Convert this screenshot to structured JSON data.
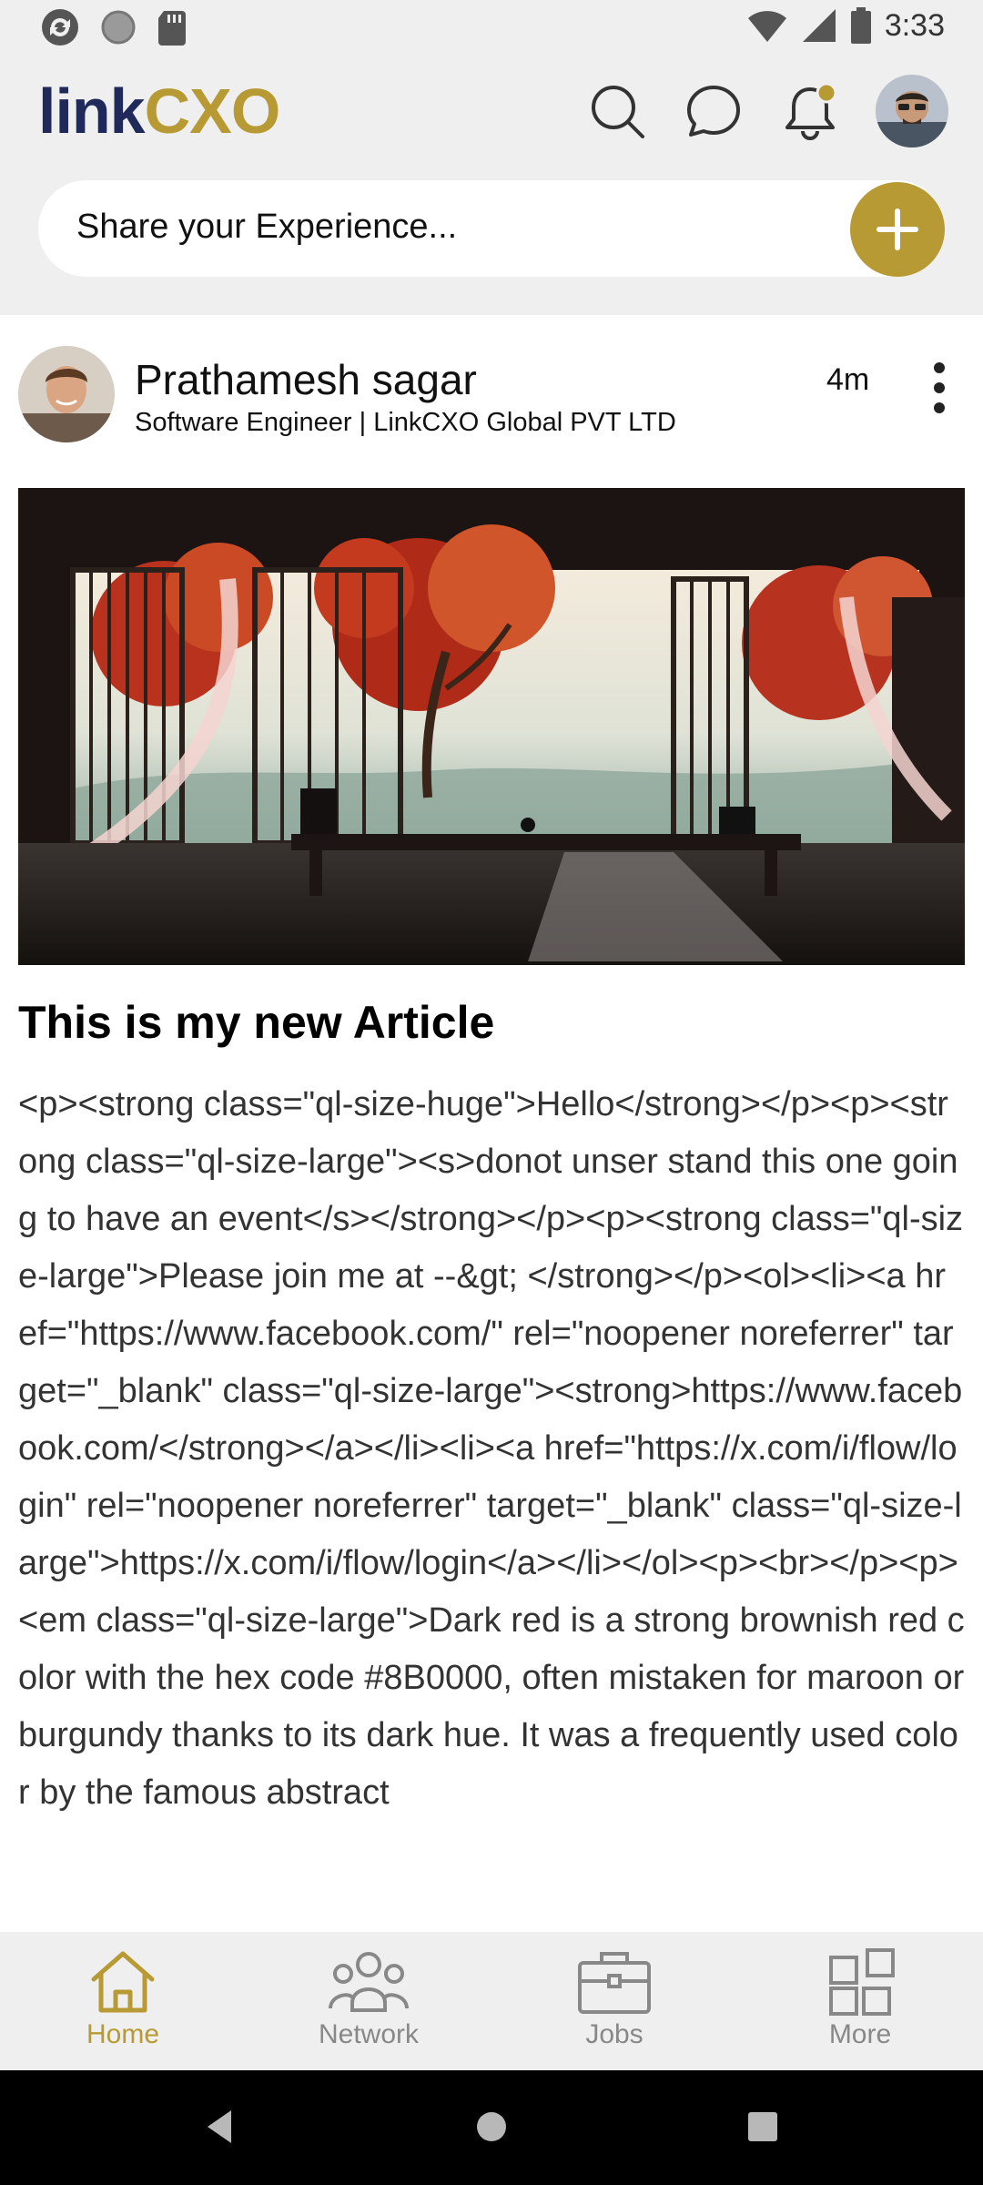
{
  "status_bar": {
    "time": "3:33",
    "left_icons": [
      "sync-icon",
      "circle-icon",
      "sdcard-icon"
    ],
    "right_icons": [
      "wifi-icon",
      "signal-icon",
      "battery-icon"
    ]
  },
  "header": {
    "logo_part1": "link",
    "logo_part2": "CXO",
    "icons": [
      "search-icon",
      "chat-icon",
      "bell-icon",
      "profile-avatar"
    ]
  },
  "share": {
    "placeholder": "Share your Experience...",
    "add_icon": "plus-icon"
  },
  "post": {
    "author_name": "Prathamesh sagar",
    "author_title": "Software  Engineer | LinkCXO Global PVT LTD",
    "time": "4m",
    "menu_icon": "more-vertical-icon",
    "title": "This is my new Article",
    "body": "<p><strong class=\"ql-size-huge\">Hello</strong></p><p><strong class=\"ql-size-large\"><s>donot unser stand this one going to have an event</s></strong></p><p><strong class=\"ql-size-large\">Please join me at  --&gt; </strong></p><ol><li><a href=\"https://www.facebook.com/\" rel=\"noopener noreferrer\" target=\"_blank\" class=\"ql-size-large\"><strong>https://www.facebook.com/</strong></a></li><li><a href=\"https://x.com/i/flow/login\" rel=\"noopener noreferrer\" target=\"_blank\" class=\"ql-size-large\">https://x.com/i/flow/login</a></li></ol><p><br></p><p><em class=\"ql-size-large\">Dark red is a strong brownish red color with the hex code #8B0000, often mistaken for maroon or burgundy thanks to its dark hue. It was a frequently used color by the famous abstract"
  },
  "bottom_nav": [
    {
      "label": "Home",
      "icon": "home-icon",
      "active": true
    },
    {
      "label": "Network",
      "icon": "network-icon",
      "active": false
    },
    {
      "label": "Jobs",
      "icon": "briefcase-icon",
      "active": false
    },
    {
      "label": "More",
      "icon": "grid-icon",
      "active": false
    }
  ],
  "colors": {
    "brand_gold": "#b79a33",
    "brand_navy": "#1f2a5a",
    "background": "#efefef"
  }
}
